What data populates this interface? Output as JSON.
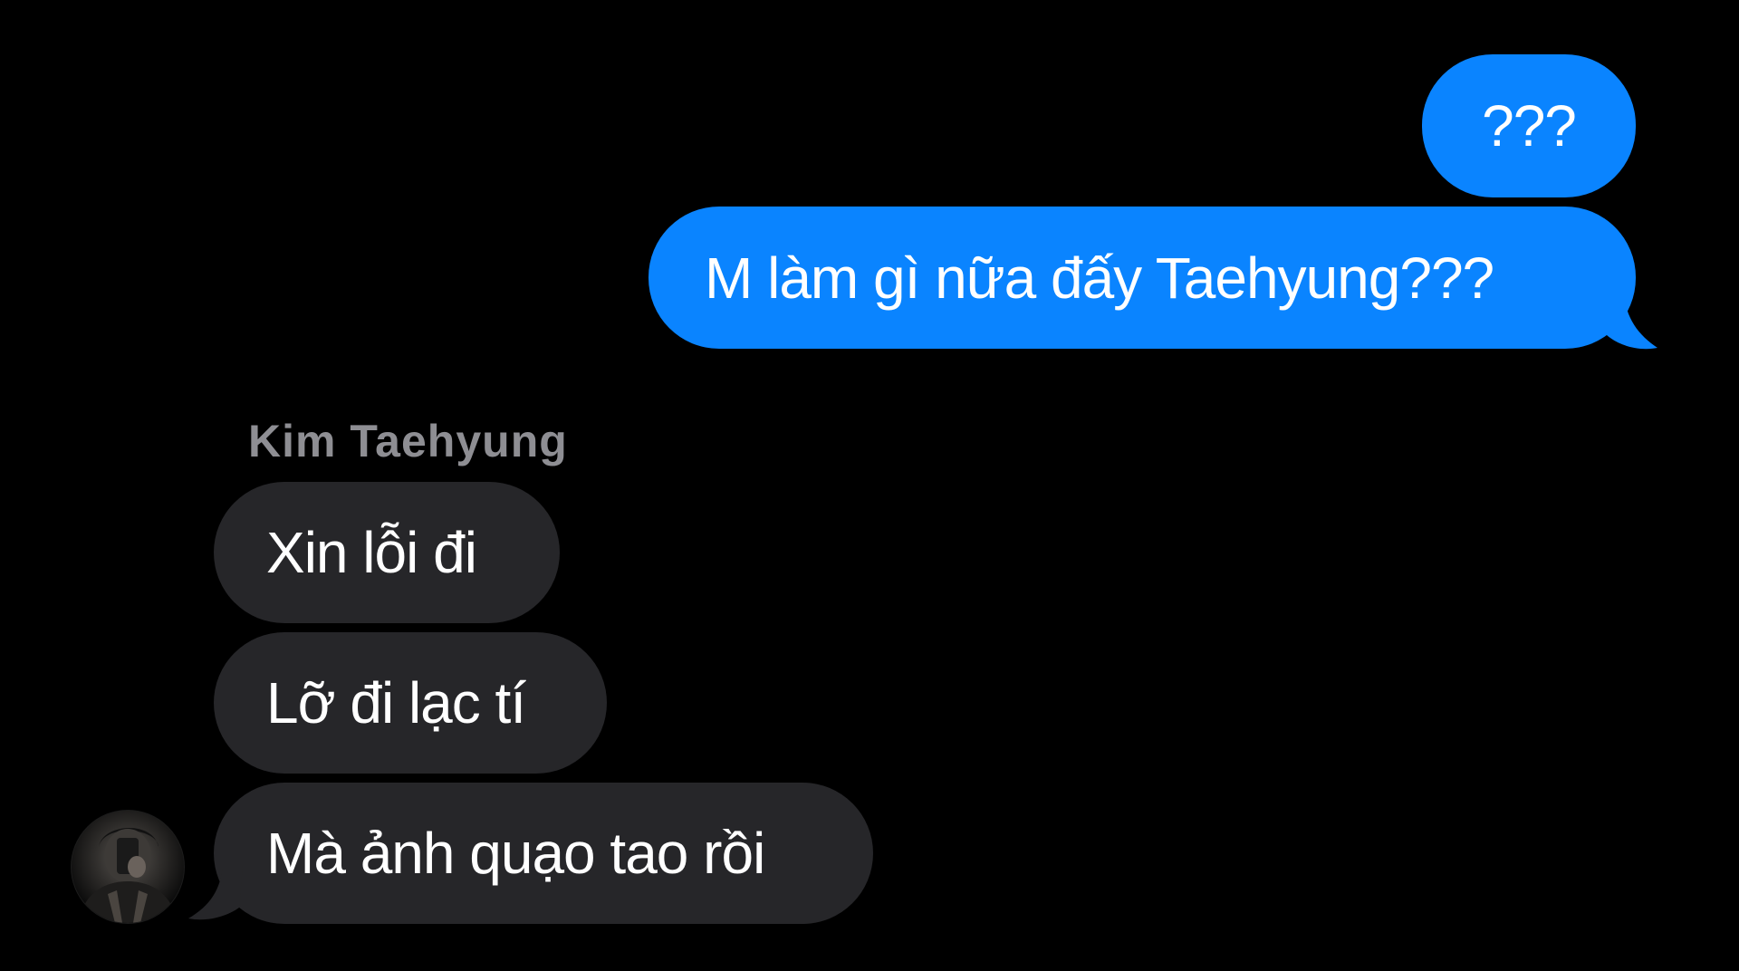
{
  "conversation": {
    "outgoing": [
      {
        "text": "???"
      },
      {
        "text": "M làm gì nữa đấy Taehyung???"
      }
    ],
    "incoming_sender": "Kim Taehyung",
    "incoming": [
      {
        "text": "Xin lỗi đi"
      },
      {
        "text": "Lỡ đi lạc tí"
      },
      {
        "text": "Mà ảnh quạo tao rồi"
      }
    ]
  },
  "colors": {
    "background": "#000000",
    "outgoing_bubble": "#0a84ff",
    "incoming_bubble": "#262629",
    "sender_name": "#8e8e93",
    "message_text": "#ffffff"
  },
  "icons": [
    "avatar-photo"
  ]
}
